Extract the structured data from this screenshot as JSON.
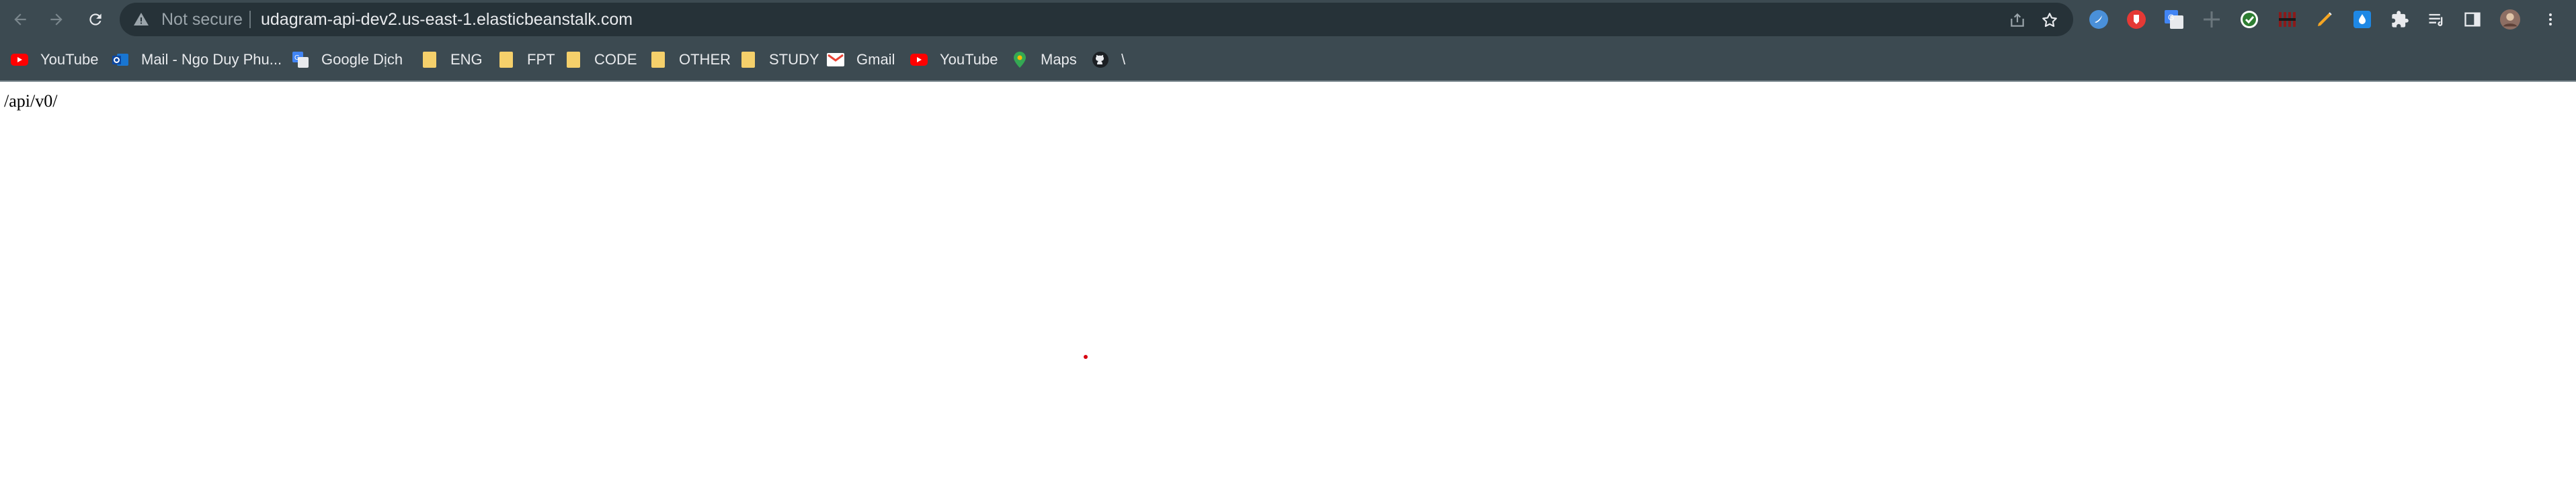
{
  "browser": {
    "omnibox": {
      "security_label": "Not secure",
      "url": "udagram-api-dev2.us-east-1.elasticbeanstalk.com"
    },
    "nav": {
      "back_icon": "arrow-left-icon",
      "forward_icon": "arrow-right-icon",
      "reload_icon": "reload-icon"
    },
    "omnibox_actions": [
      "share-icon",
      "star-icon"
    ],
    "extensions": [
      "blue-bird-extension-icon",
      "red-shield-extension-icon",
      "google-translate-extension-icon",
      "grey-plus-extension-icon",
      "green-check-extension-icon",
      "dark-red-grid-extension-icon",
      "orange-pencil-extension-icon",
      "blue-drop-extension-icon",
      "puzzle-icon",
      "media-list-icon",
      "side-panel-icon",
      "profile-avatar",
      "kebab-menu-icon"
    ]
  },
  "bookmarks": [
    {
      "label": "YouTube",
      "icon": "youtube-icon"
    },
    {
      "label": "Mail - Ngo Duy Phu...",
      "icon": "outlook-icon"
    },
    {
      "label": "Google Dịch",
      "icon": "google-translate-icon"
    },
    {
      "label": "ENG",
      "icon": "folder-icon"
    },
    {
      "label": "FPT",
      "icon": "folder-icon"
    },
    {
      "label": "CODE",
      "icon": "folder-icon"
    },
    {
      "label": "OTHER",
      "icon": "folder-icon"
    },
    {
      "label": "STUDY",
      "icon": "folder-icon"
    },
    {
      "label": "Gmail",
      "icon": "gmail-icon"
    },
    {
      "label": "YouTube",
      "icon": "youtube-icon"
    },
    {
      "label": "Maps",
      "icon": "maps-icon"
    },
    {
      "label": "\\",
      "icon": "github-icon"
    }
  ],
  "page": {
    "body_text": "/api/v0/"
  },
  "colors": {
    "toolbar": "#3c4a51",
    "omnibox": "#263238",
    "folder": "#f5d06b",
    "youtube": "#ff0000"
  }
}
